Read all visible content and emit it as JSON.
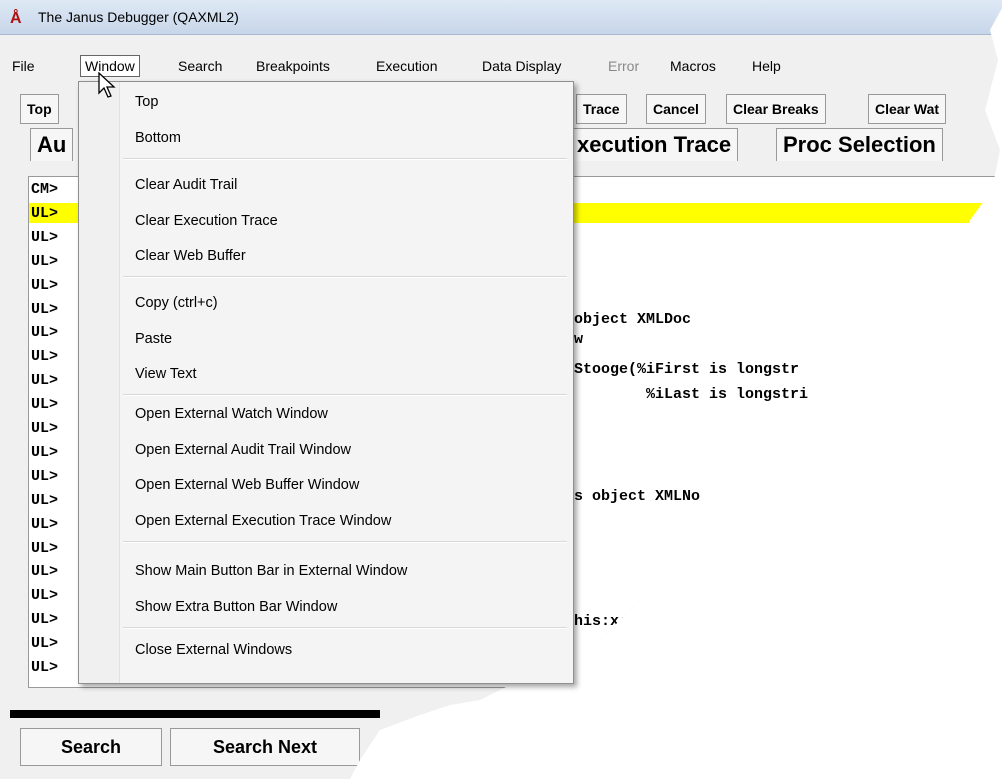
{
  "window": {
    "title": "The Janus Debugger (QAXML2)",
    "icon": "janus-bug-icon"
  },
  "menubar": {
    "items": [
      "File",
      "Window",
      "Search",
      "Breakpoints",
      "Execution",
      "Data Display",
      "Error",
      "Macros",
      "Help"
    ]
  },
  "toolbar": {
    "buttons": [
      "Top",
      "Trace",
      "Cancel",
      "Clear Breaks",
      "Clear Wat"
    ]
  },
  "tabs": [
    "Au",
    "xecution Trace",
    "Proc Selection"
  ],
  "content": {
    "prefixes": [
      "CM>",
      "UL>",
      "UL>",
      "UL>",
      "UL>",
      "UL>",
      "UL>",
      "UL>",
      "UL>",
      "UL>",
      "UL>",
      "UL>",
      "UL>",
      "UL>",
      "UL>",
      "UL>",
      "UL>",
      "UL>",
      "UL>",
      "UL>",
      "UL>"
    ],
    "code_lines": [
      "object XMLDoc",
      "w",
      "Stooge(%iFirst is longstr",
      "        %iLast is longstri",
      "s object XMLNo",
      "his:x:addE"
    ]
  },
  "bottom_buttons": [
    "Search",
    "Search Next"
  ],
  "dropdown": {
    "groups": [
      [
        "Top",
        "Bottom"
      ],
      [
        "Clear Audit Trail",
        "Clear Execution Trace",
        "Clear Web Buffer"
      ],
      [
        "Copy (ctrl+c)",
        "Paste",
        "View Text"
      ],
      [
        "Open External Watch Window",
        "Open External Audit Trail Window",
        "Open External Web Buffer Window",
        "Open External Execution Trace Window"
      ],
      [
        "Show Main Button Bar in External Window",
        "Show Extra Button Bar Window"
      ],
      [
        "Close External Windows"
      ]
    ]
  },
  "colors": {
    "highlight": "#ffff00",
    "menu_bg": "#f4f4f4"
  }
}
